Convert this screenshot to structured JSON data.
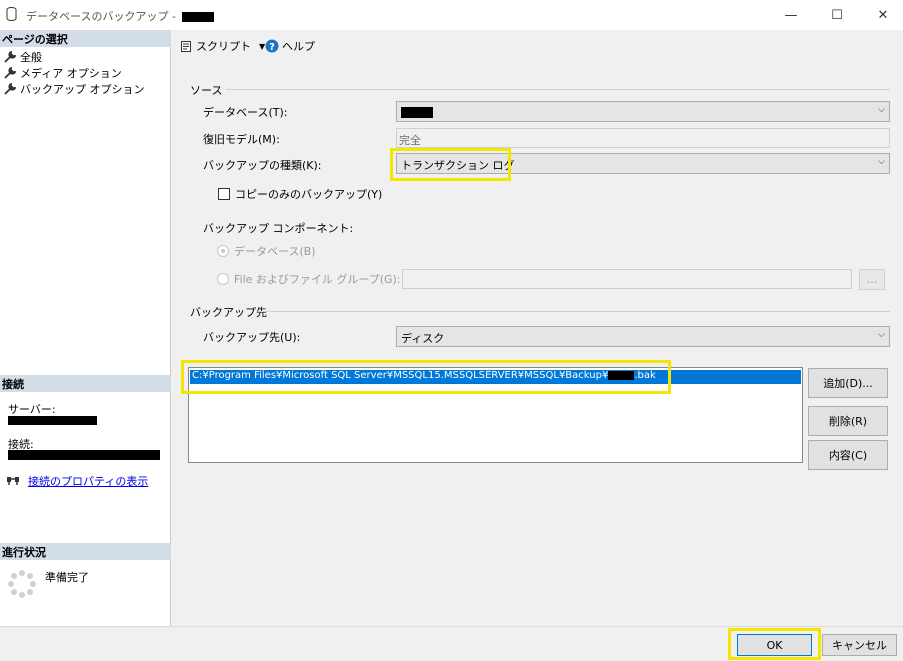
{
  "window": {
    "title": "データベースのバックアップ -",
    "min_glyph": "—",
    "max_glyph": "☐",
    "close_glyph": "✕"
  },
  "left": {
    "select_page_header": "ページの選択",
    "pages": [
      "全般",
      "メディア オプション",
      "バックアップ オプション"
    ],
    "connection_header": "接続",
    "server_label": "サーバー:",
    "connection_label": "接続:",
    "view_props_link": "接続のプロパティの表示",
    "progress_header": "進行状況",
    "progress_status": "準備完了"
  },
  "toolbar": {
    "script_label": "スクリプト",
    "help_label": "ヘルプ"
  },
  "source": {
    "group_label": "ソース",
    "database_label": "データベース(T):",
    "recovery_label": "復旧モデル(M):",
    "recovery_value": "完全",
    "backup_type_label": "バックアップの種類(K):",
    "backup_type_value": "トランザクション ログ",
    "copy_only_label": "コピーのみのバックアップ(Y)",
    "component_label": "バックアップ コンポーネント:",
    "radio_database": "データベース(B)",
    "radio_files": "File およびファイル グループ(G):",
    "browse_label": "..."
  },
  "destination": {
    "group_label": "バックアップ先",
    "backup_to_label": "バックアップ先(U):",
    "backup_to_value": "ディスク",
    "path_prefix": "C:¥Program Files¥Microsoft SQL Server¥MSSQL15.MSSQLSERVER¥MSSQL¥Backup¥",
    "path_suffix": ".bak",
    "add_button": "追加(D)...",
    "remove_button": "削除(R)",
    "contents_button": "内容(C)"
  },
  "footer": {
    "ok_button": "OK",
    "cancel_button": "キャンセル"
  },
  "colors": {
    "highlight": "#f3e600",
    "selection": "#0078d7",
    "section_header": "#d3dde8"
  }
}
